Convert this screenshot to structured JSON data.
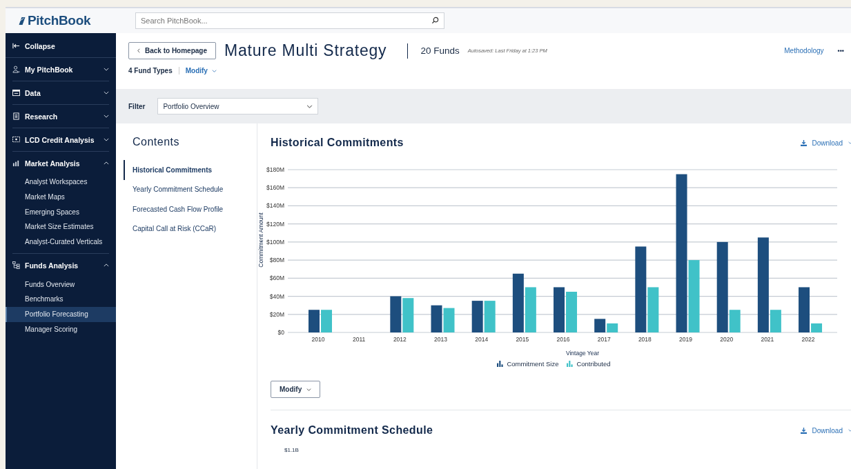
{
  "topbar": {
    "logo": "PitchBook",
    "search": {
      "placeholder": "Search PitchBook..."
    }
  },
  "sidebar": {
    "collapse": "Collapse",
    "sections": [
      {
        "label": "My PitchBook",
        "expanded": false
      },
      {
        "label": "Data",
        "expanded": false
      },
      {
        "label": "Research",
        "expanded": false
      },
      {
        "label": "LCD Credit Analysis",
        "expanded": false
      },
      {
        "label": "Market Analysis",
        "expanded": true,
        "children": [
          {
            "label": "Analyst Workspaces",
            "selected": false
          },
          {
            "label": "Market Maps",
            "selected": false
          },
          {
            "label": "Emerging Spaces",
            "selected": false
          },
          {
            "label": "Market Size Estimates",
            "selected": false
          },
          {
            "label": "Analyst-Curated Verticals",
            "selected": false
          }
        ]
      },
      {
        "label": "Funds Analysis",
        "expanded": true,
        "children": [
          {
            "label": "Funds Overview",
            "selected": false
          },
          {
            "label": "Benchmarks",
            "selected": false
          },
          {
            "label": "Portfolio Forecasting",
            "selected": true
          },
          {
            "label": "Manager Scoring",
            "selected": false
          }
        ]
      }
    ]
  },
  "header": {
    "back": "Back to Homepage",
    "title": "Mature Multi Strategy",
    "funds": "20 Funds",
    "autosaved": "Autosaved: Last Friday at 1:23 PM",
    "methodology": "Methodology",
    "more": "•••",
    "fund_types": "4 Fund Types",
    "modify": "Modify"
  },
  "filter": {
    "label": "Filter",
    "value": "Portfolio Overview"
  },
  "contents": {
    "title": "Contents",
    "items": [
      {
        "label": "Historical Commitments",
        "selected": true
      },
      {
        "label": "Yearly Commitment Schedule",
        "selected": false
      },
      {
        "label": "Forecasted Cash Flow Profile",
        "selected": false
      },
      {
        "label": "Capital Call at Risk (CCaR)",
        "selected": false
      }
    ]
  },
  "sections": [
    {
      "title": "Historical Commitments",
      "download": "Download",
      "modify": "Modify",
      "chart_data": {
        "type": "bar",
        "xlabel": "Vintage Year",
        "ylabel": "Commitment Amount",
        "categories": [
          "2010",
          "2011",
          "2012",
          "2013",
          "2014",
          "2015",
          "2016",
          "2017",
          "2018",
          "2019",
          "2020",
          "2021",
          "2022"
        ],
        "series": [
          {
            "name": "Commitment Size",
            "color": "#1d4e7e",
            "values": [
              25,
              null,
              40,
              30,
              35,
              65,
              50,
              15,
              95,
              175,
              100,
              105,
              50
            ]
          },
          {
            "name": "Contributed",
            "color": "#40c2c8",
            "values": [
              25,
              null,
              38,
              27,
              35,
              50,
              45,
              10,
              50,
              80,
              25,
              25,
              10
            ]
          }
        ],
        "grid": true,
        "legend": "bottom",
        "ylim": [
          0,
          180
        ],
        "yticks": [
          {
            "value": 0,
            "label": "$0"
          },
          {
            "value": 20,
            "label": "$20M"
          },
          {
            "value": 40,
            "label": "$40M"
          },
          {
            "value": 60,
            "label": "$60M"
          },
          {
            "value": 80,
            "label": "$80M"
          },
          {
            "value": 100,
            "label": "$100M"
          },
          {
            "value": 120,
            "label": "$120M"
          },
          {
            "value": 140,
            "label": "$140M"
          },
          {
            "value": 160,
            "label": "$160M"
          },
          {
            "value": 180,
            "label": "$180M"
          }
        ]
      }
    },
    {
      "title": "Yearly Commitment Schedule",
      "download": "Download",
      "first_tick": "$1.1B"
    }
  ]
}
